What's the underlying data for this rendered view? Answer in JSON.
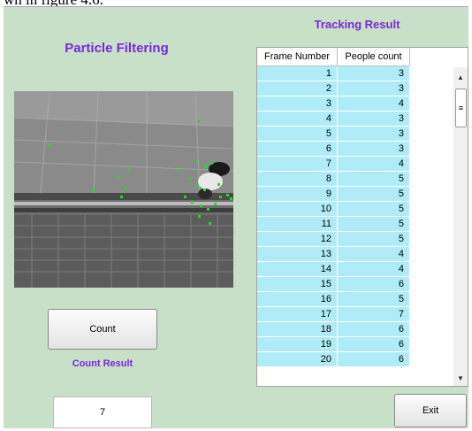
{
  "caption": "wn in figure 4.6.",
  "app": {
    "title": "Particle Filtering",
    "tracking_title": "Tracking Result",
    "count_button": "Count",
    "count_result_label": "Count Result",
    "count_result_value": "7",
    "exit_button": "Exit"
  },
  "table": {
    "headers": [
      "Frame Number",
      "People count"
    ],
    "rows": [
      [
        "1",
        "3"
      ],
      [
        "2",
        "3"
      ],
      [
        "3",
        "4"
      ],
      [
        "4",
        "3"
      ],
      [
        "5",
        "3"
      ],
      [
        "6",
        "3"
      ],
      [
        "7",
        "4"
      ],
      [
        "8",
        "5"
      ],
      [
        "9",
        "5"
      ],
      [
        "10",
        "5"
      ],
      [
        "11",
        "5"
      ],
      [
        "12",
        "5"
      ],
      [
        "13",
        "4"
      ],
      [
        "14",
        "4"
      ],
      [
        "15",
        "6"
      ],
      [
        "16",
        "5"
      ],
      [
        "17",
        "7"
      ],
      [
        "18",
        "6"
      ],
      [
        "19",
        "6"
      ],
      [
        "20",
        "6"
      ]
    ]
  },
  "colors": {
    "accent": "#7a28d8",
    "panel": "#c8e0c8",
    "cell": "#b0ecf8",
    "particle": "#22dd22"
  }
}
